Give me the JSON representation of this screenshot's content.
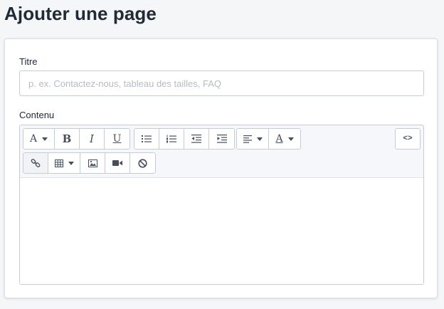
{
  "page": {
    "title": "Ajouter une page"
  },
  "form": {
    "title_label": "Titre",
    "title_placeholder": "p. ex. Contactez-nous, tableau des tailles, FAQ",
    "title_value": "",
    "content_label": "Contenu",
    "content_value": ""
  },
  "toolbar": {
    "font_glyph": "A",
    "bold_glyph": "B",
    "italic_glyph": "I",
    "underline_glyph": "U",
    "text_color_glyph": "A",
    "code_glyph": "<>"
  },
  "icons": {
    "font": "font-icon",
    "bold": "bold-icon",
    "italic": "italic-icon",
    "underline": "underline-icon",
    "bullet_list": "bullet-list-icon",
    "numbered_list": "numbered-list-icon",
    "outdent": "outdent-icon",
    "indent": "indent-icon",
    "align": "align-left-icon",
    "text_color": "text-color-icon",
    "code": "code-icon",
    "link": "link-icon",
    "table": "table-icon",
    "image": "image-icon",
    "video": "video-icon",
    "clear": "clear-formatting-icon"
  },
  "colors": {
    "background": "#f4f6f8",
    "card": "#ffffff",
    "border": "#c4cdd5",
    "toolbar": "#f5f7fa",
    "text": "#212b36"
  }
}
